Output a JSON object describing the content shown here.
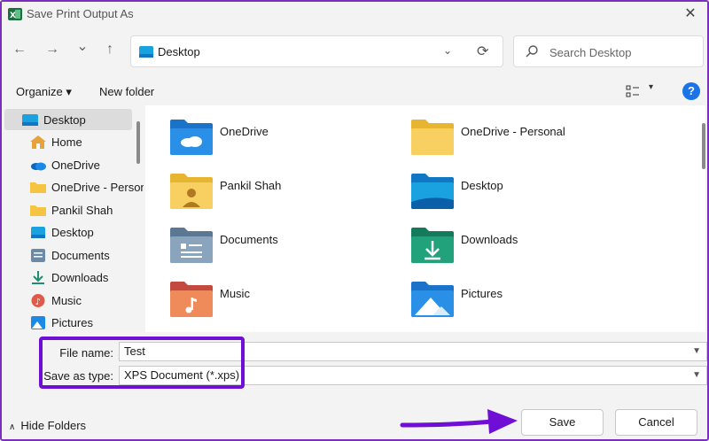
{
  "window": {
    "title": "Save Print Output As",
    "close_glyph": "✕"
  },
  "nav_buttons": {
    "back": "←",
    "forward": "→",
    "recent": "⌄",
    "up": "↑"
  },
  "address": {
    "path": "Desktop",
    "chevron": "⌄",
    "refresh": "⟳"
  },
  "search": {
    "placeholder": "Search Desktop"
  },
  "commands": {
    "organize": "Organize ▾",
    "new_folder": "New folder",
    "view_chevron": "▾",
    "help": "?"
  },
  "sidebar": {
    "items": [
      {
        "label": "Desktop",
        "icon": "desktop-icon",
        "selected": true
      },
      {
        "label": "Home",
        "icon": "home-icon"
      },
      {
        "label": "OneDrive",
        "icon": "onedrive-icon"
      },
      {
        "label": "OneDrive - Personal",
        "icon": "folder-icon"
      },
      {
        "label": "Pankil Shah",
        "icon": "folder-icon"
      },
      {
        "label": "Desktop",
        "icon": "desktop-icon"
      },
      {
        "label": "Documents",
        "icon": "documents-icon"
      },
      {
        "label": "Downloads",
        "icon": "downloads-icon"
      },
      {
        "label": "Music",
        "icon": "music-icon"
      },
      {
        "label": "Pictures",
        "icon": "pictures-icon"
      }
    ]
  },
  "files": [
    {
      "name": "OneDrive",
      "icon": "onedrive-folder-icon"
    },
    {
      "name": "OneDrive - Personal",
      "icon": "folder-icon"
    },
    {
      "name": "Pankil Shah",
      "icon": "user-folder-icon"
    },
    {
      "name": "Desktop",
      "icon": "desktop-folder-icon"
    },
    {
      "name": "Documents",
      "icon": "documents-folder-icon"
    },
    {
      "name": "Downloads",
      "icon": "downloads-folder-icon"
    },
    {
      "name": "Music",
      "icon": "music-folder-icon"
    },
    {
      "name": "Pictures",
      "icon": "pictures-folder-icon"
    }
  ],
  "form": {
    "file_name_label": "File name:",
    "file_name_value": "Test",
    "save_type_label": "Save as type:",
    "save_type_value": "XPS Document (*.xps)"
  },
  "footer": {
    "hide_folders_chevron": "∧",
    "hide_folders": "Hide Folders",
    "save": "Save",
    "cancel": "Cancel"
  },
  "colors": {
    "highlight": "#6f0fd6",
    "accent": "#1a73e8",
    "window_border": "#7a2fbd"
  }
}
